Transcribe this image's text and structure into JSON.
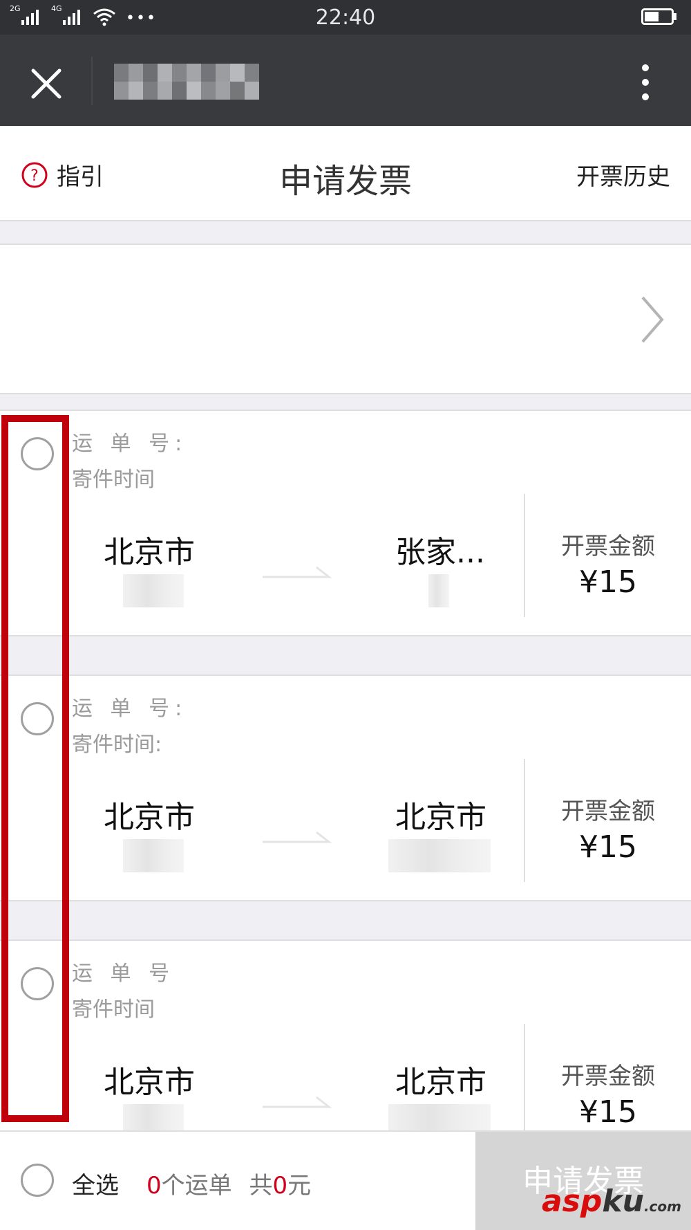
{
  "status_bar": {
    "network_1": "2G",
    "network_2": "4G",
    "overflow_dots": "•••",
    "time": "22:40"
  },
  "header": {
    "guide_label": "指引",
    "title": "申请发票",
    "history_label": "开票历史"
  },
  "orders": [
    {
      "waybill_label": "运 单 号:",
      "time_label": "寄件时间",
      "from_city": "北京市",
      "to_city": "张家...",
      "amount_label": "开票金额",
      "amount": "¥15"
    },
    {
      "waybill_label": "运 单 号:",
      "time_label": "寄件时间:",
      "from_city": "北京市",
      "to_city": "北京市",
      "amount_label": "开票金额",
      "amount": "¥15"
    },
    {
      "waybill_label": "运 单 号",
      "time_label": "寄件时间",
      "from_city": "北京市",
      "to_city": "北京市",
      "amount_label": "开票金额",
      "amount": "¥15"
    }
  ],
  "footer": {
    "select_all_label": "全选",
    "order_count": "0",
    "order_unit": "个运单",
    "total_prefix": "共",
    "total_value": "0",
    "total_unit": "元",
    "submit_label": "申请发票"
  },
  "watermark": {
    "brand": "asp",
    "brand_tail": "ku",
    "domain": ".com"
  },
  "colors": {
    "accent_red": "#c0000b",
    "summary_red": "#d0021b",
    "nav_bg": "#393a3e"
  }
}
